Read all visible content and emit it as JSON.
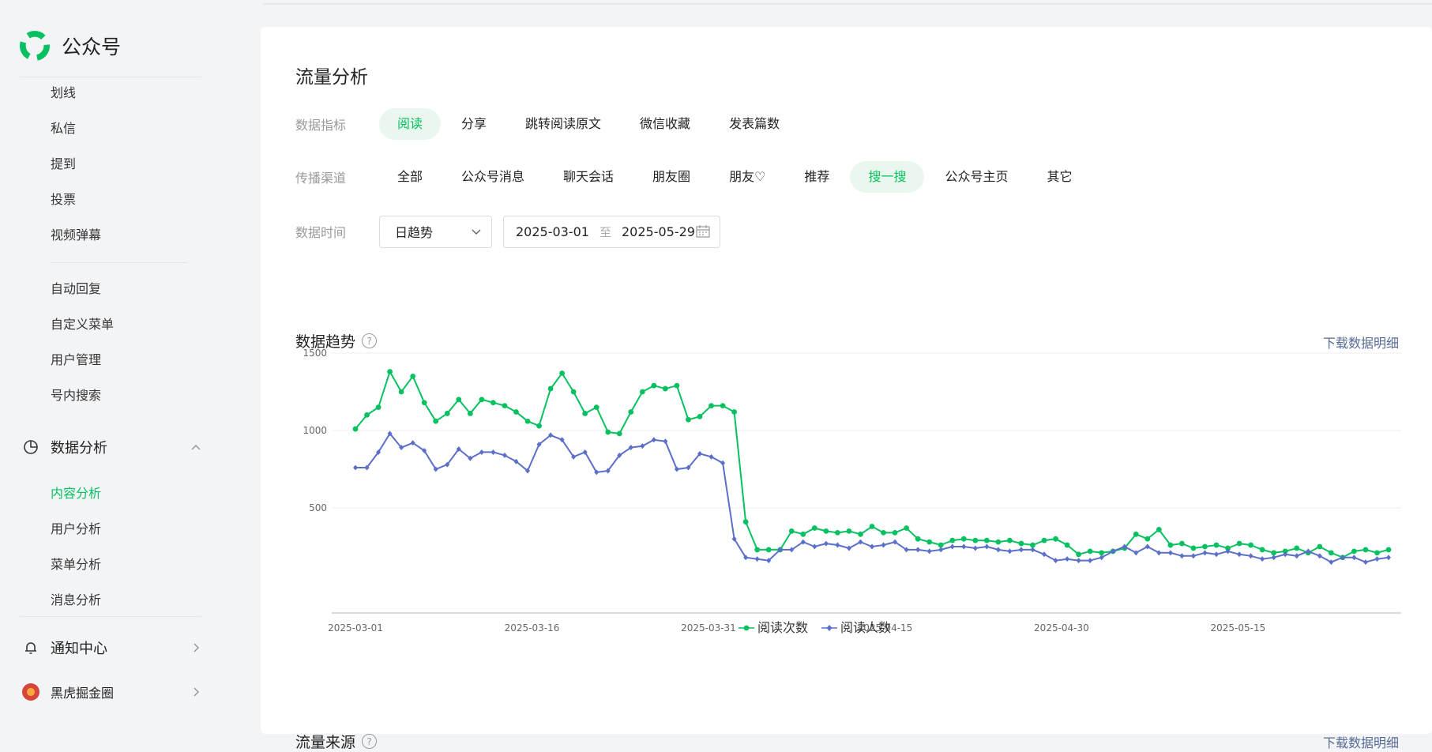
{
  "brand": {
    "name": "公众号"
  },
  "sidebar": {
    "items_top": [
      "划线",
      "私信",
      "提到",
      "投票",
      "视频弹幕"
    ],
    "items_mid": [
      "自动回复",
      "自定义菜单",
      "用户管理",
      "号内搜索"
    ],
    "data_group": {
      "label": "数据分析"
    },
    "data_items": [
      "内容分析",
      "用户分析",
      "菜单分析",
      "消息分析"
    ],
    "notice": {
      "label": "通知中心"
    },
    "account": {
      "label": "黑虎掘金圈"
    }
  },
  "main": {
    "title": "流量分析",
    "metric": {
      "label": "数据指标",
      "options": [
        "阅读",
        "分享",
        "跳转阅读原文",
        "微信收藏",
        "发表篇数"
      ]
    },
    "channel": {
      "label": "传播渠道",
      "options": [
        "全部",
        "公众号消息",
        "聊天会话",
        "朋友圈",
        "朋友♡",
        "推荐",
        "搜一搜",
        "公众号主页",
        "其它"
      ]
    },
    "time": {
      "label": "数据时间",
      "granularity": "日趋势",
      "start": "2025-03-01",
      "sep": "至",
      "end": "2025-05-29"
    },
    "trend": {
      "title": "数据趋势",
      "help": "?",
      "download": "下载数据明细"
    },
    "source": {
      "title": "流量来源",
      "help": "?",
      "download": "下载数据明细"
    }
  },
  "colors": {
    "accent": "#07c160",
    "series1": "#07c160",
    "series2": "#5b6fc9",
    "link": "#576b95"
  },
  "chart_data": {
    "type": "line",
    "x_start": "2025-03-01",
    "x_end": "2025-05-29",
    "x_ticks": [
      "2025-03-01",
      "2025-03-16",
      "2025-03-31",
      "2025-04-15",
      "2025-04-30",
      "2025-05-15"
    ],
    "y_ticks": [
      500,
      1000,
      1500
    ],
    "ylim": [
      0,
      1500
    ],
    "legend_position": "bottom",
    "series": [
      {
        "name": "阅读次数",
        "marker": "circle",
        "values": [
          1010,
          1100,
          1150,
          1380,
          1250,
          1350,
          1180,
          1060,
          1110,
          1200,
          1110,
          1200,
          1180,
          1160,
          1120,
          1060,
          1030,
          1270,
          1370,
          1250,
          1110,
          1150,
          990,
          980,
          1120,
          1250,
          1290,
          1270,
          1290,
          1070,
          1090,
          1160,
          1160,
          1120,
          410,
          230,
          230,
          230,
          350,
          330,
          370,
          350,
          340,
          350,
          330,
          380,
          340,
          340,
          370,
          300,
          280,
          260,
          290,
          300,
          290,
          290,
          280,
          290,
          270,
          260,
          290,
          300,
          260,
          200,
          220,
          210,
          220,
          240,
          330,
          300,
          360,
          260,
          270,
          240,
          250,
          260,
          240,
          270,
          260,
          230,
          210,
          220,
          240,
          210,
          250,
          210,
          180,
          220,
          230,
          210,
          230
        ]
      },
      {
        "name": "阅读人数",
        "marker": "diamond",
        "values": [
          760,
          760,
          860,
          980,
          890,
          920,
          870,
          750,
          780,
          880,
          820,
          860,
          860,
          840,
          800,
          740,
          910,
          970,
          940,
          830,
          860,
          730,
          740,
          840,
          890,
          900,
          940,
          930,
          750,
          760,
          850,
          830,
          790,
          300,
          180,
          170,
          160,
          230,
          230,
          280,
          250,
          270,
          260,
          240,
          280,
          250,
          260,
          280,
          230,
          230,
          220,
          230,
          250,
          250,
          240,
          250,
          230,
          220,
          230,
          230,
          200,
          160,
          170,
          160,
          160,
          180,
          220,
          250,
          210,
          250,
          210,
          210,
          190,
          190,
          210,
          200,
          220,
          200,
          190,
          170,
          180,
          200,
          190,
          220,
          190,
          150,
          180,
          180,
          150,
          170,
          180
        ]
      }
    ]
  }
}
